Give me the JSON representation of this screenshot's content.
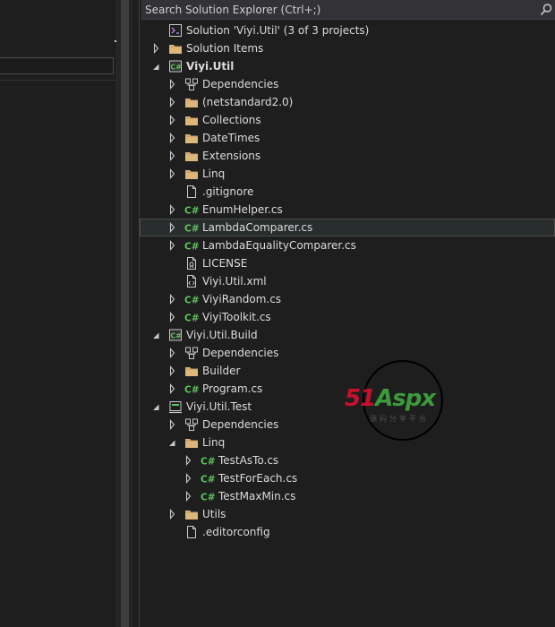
{
  "search": {
    "placeholder": "Search Solution Explorer (Ctrl+;)"
  },
  "tree": [
    {
      "text": "Solution 'Viyi.Util' (3 of 3 projects)",
      "icon": "solution-icon",
      "level": 0,
      "arrow": "none",
      "bold": false
    },
    {
      "text": "Solution Items",
      "icon": "folder-icon",
      "level": 0,
      "arrow": "collapsed",
      "bold": false
    },
    {
      "text": "Viyi.Util",
      "icon": "csharp-project-icon",
      "level": 0,
      "arrow": "expanded",
      "bold": true
    },
    {
      "text": "Dependencies",
      "icon": "dependencies-icon",
      "level": 1,
      "arrow": "collapsed",
      "bold": false
    },
    {
      "text": "(netstandard2.0)",
      "icon": "folder-icon",
      "level": 1,
      "arrow": "collapsed",
      "bold": false
    },
    {
      "text": "Collections",
      "icon": "folder-icon",
      "level": 1,
      "arrow": "collapsed",
      "bold": false
    },
    {
      "text": "DateTimes",
      "icon": "folder-icon",
      "level": 1,
      "arrow": "collapsed",
      "bold": false
    },
    {
      "text": "Extensions",
      "icon": "folder-icon",
      "level": 1,
      "arrow": "collapsed",
      "bold": false
    },
    {
      "text": "Linq",
      "icon": "folder-icon",
      "level": 1,
      "arrow": "collapsed",
      "bold": false
    },
    {
      "text": ".gitignore",
      "icon": "file-icon",
      "level": 1,
      "arrow": "none",
      "bold": false
    },
    {
      "text": "EnumHelper.cs",
      "icon": "csharp-file-icon",
      "level": 1,
      "arrow": "collapsed",
      "bold": false
    },
    {
      "text": "LambdaComparer.cs",
      "icon": "csharp-file-icon",
      "level": 1,
      "arrow": "collapsed",
      "bold": false,
      "selected": true
    },
    {
      "text": "LambdaEqualityComparer.cs",
      "icon": "csharp-file-icon",
      "level": 1,
      "arrow": "collapsed",
      "bold": false
    },
    {
      "text": "LICENSE",
      "icon": "license-file-icon",
      "level": 1,
      "arrow": "none",
      "bold": false
    },
    {
      "text": "Viyi.Util.xml",
      "icon": "xml-file-icon",
      "level": 1,
      "arrow": "none",
      "bold": false
    },
    {
      "text": "ViyiRandom.cs",
      "icon": "csharp-file-icon",
      "level": 1,
      "arrow": "collapsed",
      "bold": false
    },
    {
      "text": "ViyiToolkit.cs",
      "icon": "csharp-file-icon",
      "level": 1,
      "arrow": "collapsed",
      "bold": false
    },
    {
      "text": "Viyi.Util.Build",
      "icon": "csharp-project-icon",
      "level": 0,
      "arrow": "expanded",
      "bold": false
    },
    {
      "text": "Dependencies",
      "icon": "dependencies-icon",
      "level": 1,
      "arrow": "collapsed",
      "bold": false
    },
    {
      "text": "Builder",
      "icon": "folder-icon",
      "level": 1,
      "arrow": "collapsed",
      "bold": false
    },
    {
      "text": "Program.cs",
      "icon": "csharp-file-icon",
      "level": 1,
      "arrow": "collapsed",
      "bold": false
    },
    {
      "text": "Viyi.Util.Test",
      "icon": "test-project-icon",
      "level": 0,
      "arrow": "expanded",
      "bold": false
    },
    {
      "text": "Dependencies",
      "icon": "dependencies-icon",
      "level": 1,
      "arrow": "collapsed",
      "bold": false
    },
    {
      "text": "Linq",
      "icon": "folder-icon",
      "level": 1,
      "arrow": "expanded",
      "bold": false
    },
    {
      "text": "TestAsTo.cs",
      "icon": "csharp-file-icon",
      "level": 2,
      "arrow": "collapsed",
      "bold": false
    },
    {
      "text": "TestForEach.cs",
      "icon": "csharp-file-icon",
      "level": 2,
      "arrow": "collapsed",
      "bold": false
    },
    {
      "text": "TestMaxMin.cs",
      "icon": "csharp-file-icon",
      "level": 2,
      "arrow": "collapsed",
      "bold": false
    },
    {
      "text": "Utils",
      "icon": "folder-icon",
      "level": 1,
      "arrow": "collapsed",
      "bold": false
    },
    {
      "text": ".editorconfig",
      "icon": "file-icon",
      "level": 1,
      "arrow": "none",
      "bold": false
    }
  ],
  "watermark": {
    "brand_red": "51",
    "brand_rest": "Aspx",
    "sub": "源码分享平台"
  },
  "colors": {
    "folder": "#dcb67a",
    "csharp": "#5fc25f",
    "selection": "#2a2d2e",
    "brand_red": "#c8102e",
    "brand_green": "#3c9a3c"
  }
}
